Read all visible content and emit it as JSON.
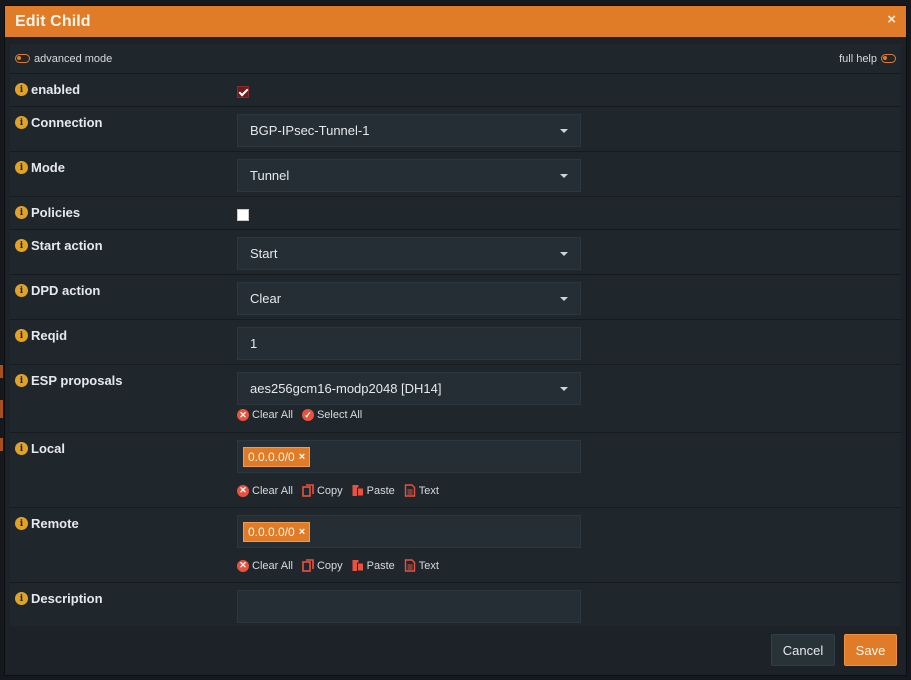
{
  "dialog": {
    "title": "Edit Child",
    "close_glyph": "×",
    "advanced_mode_label": "advanced mode",
    "full_help_label": "full help"
  },
  "fields": {
    "enabled": {
      "label": "enabled",
      "checked": true
    },
    "connection": {
      "label": "Connection",
      "value": "BGP-IPsec-Tunnel-1"
    },
    "mode": {
      "label": "Mode",
      "value": "Tunnel"
    },
    "policies": {
      "label": "Policies",
      "checked": false
    },
    "start_action": {
      "label": "Start action",
      "value": "Start"
    },
    "dpd_action": {
      "label": "DPD action",
      "value": "Clear"
    },
    "reqid": {
      "label": "Reqid",
      "value": "1"
    },
    "esp_proposals": {
      "label": "ESP proposals",
      "value": "aes256gcm16-modp2048 [DH14]",
      "clear_all": "Clear All",
      "select_all": "Select All"
    },
    "local": {
      "label": "Local",
      "tag": "0.0.0.0/0",
      "clear_all": "Clear All",
      "copy": "Copy",
      "paste": "Paste",
      "text": "Text"
    },
    "remote": {
      "label": "Remote",
      "tag": "0.0.0.0/0",
      "clear_all": "Clear All",
      "copy": "Copy",
      "paste": "Paste",
      "text": "Text"
    },
    "description": {
      "label": "Description",
      "value": ""
    }
  },
  "footer": {
    "cancel_label": "Cancel",
    "save_label": "Save"
  },
  "icons": {
    "info": "info-icon",
    "tag_remove": "×"
  },
  "colors": {
    "accent": "#e07c28",
    "info": "#e0a328",
    "danger": "#e8523f",
    "panel": "#1f262c",
    "field": "#252e35"
  }
}
